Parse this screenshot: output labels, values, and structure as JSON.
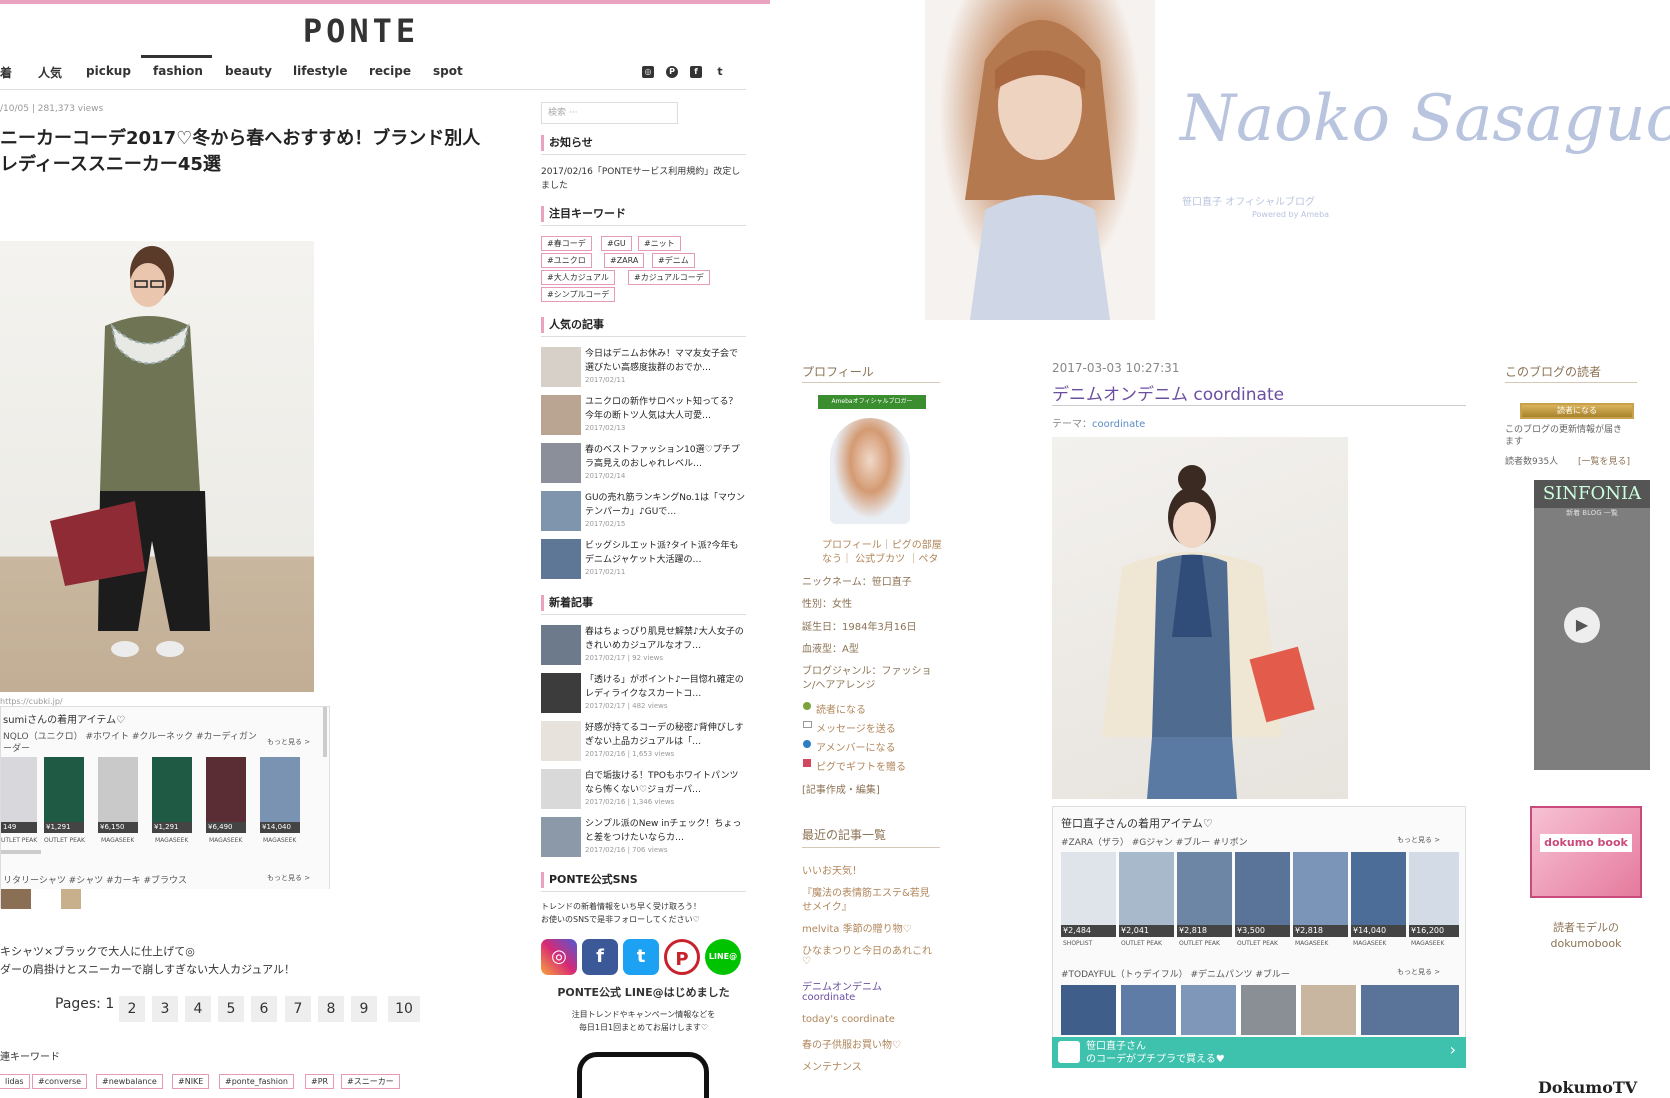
{
  "ponte": {
    "logo": "PONTE",
    "nav": [
      "着",
      "人気",
      "pickup",
      "fashion",
      "beauty",
      "lifestyle",
      "recipe",
      "spot"
    ],
    "social_icons": [
      "instagram-icon",
      "pinterest-icon",
      "facebook-icon",
      "twitter-icon"
    ],
    "meta": "/10/05 | 281,373 views",
    "title_line1": "ニーカーコーデ2017♡冬から春へおすすめ！ブランド別人",
    "title_line2": "レディーススニーカー45選",
    "photo_credit": "https://cubki.jp/",
    "items_box": {
      "heading": "sumiさんの着用アイテム♡",
      "tags_line": "NQLO（ユニクロ） #ホワイト #クルーネック #カーディガン",
      "tags_line2": "ーダー",
      "more": "もっと見る >",
      "prices": [
        "149",
        "¥1,291",
        "¥6,150",
        "¥1,291",
        "¥6,490",
        "¥14,040"
      ],
      "shops": [
        "UTLET PEAK",
        "OUTLET PEAK",
        "MAGASEEK",
        "MAGASEEK",
        "MAGASEEK",
        "MAGASEEK"
      ],
      "tags_line3": "リタリーシャツ #シャツ #カーキ #ブラウス",
      "more2": "もっと見る >"
    },
    "caption1": "キシャツ×ブラックで大人に仕上げて◎",
    "caption2": "ダーの肩掛けとスニーカーで崩しすぎない大人カジュアル！",
    "pages_label": "Pages:",
    "current_page": "1",
    "pages": [
      "2",
      "3",
      "4",
      "5",
      "6",
      "7",
      "8",
      "9",
      "10"
    ],
    "keywords_heading": "連キーワード",
    "bottom_tags": [
      "lidas",
      "#converse",
      "#newbalance",
      "#NIKE",
      "#ponte_fashion",
      "#PR",
      "#スニーカー"
    ],
    "sidebar": {
      "search_placeholder": "検索 ···",
      "news_heading": "お知らせ",
      "news_text": "2017/02/16「PONTEサービス利用規約」改定しました",
      "keywords_heading": "注目キーワード",
      "keyword_tags": [
        "#春コーデ",
        "#GU",
        "#ニット",
        "#ユニクロ",
        "#ZARA",
        "#デニム",
        "#大人カジュアル",
        "#カジュアルコーデ",
        "#シンプルコーデ"
      ],
      "popular_heading": "人気の記事",
      "popular": [
        {
          "title": "今日はデニムお休み！ママ友女子会で選びたい高感度抜群のおでか…",
          "date": "2017/02/11"
        },
        {
          "title": "ユニクロの新作サロペット知ってる？今年の断トツ人気は大人可愛…",
          "date": "2017/02/13"
        },
        {
          "title": "春のベストファッション10選♡プチプラ高見えのおしゃれレベル…",
          "date": "2017/02/14"
        },
        {
          "title": "GUの売れ筋ランキングNo.1は「マウンテンパーカ」♪GUで…",
          "date": "2017/02/15"
        },
        {
          "title": "ビッグシルエット派?タイト派?今年もデニムジャケット大活躍の…",
          "date": "2017/02/11"
        }
      ],
      "new_heading": "新着記事",
      "new_articles": [
        {
          "title": "春はちょっぴり肌見せ解禁♪大人女子のきれいめカジュアルなオフ…",
          "date": "2017/02/17 | 92 views"
        },
        {
          "title": "「透ける」がポイント♪一目惚れ確定のレディライクなスカートコ…",
          "date": "2017/02/17 | 482 views"
        },
        {
          "title": "好感が持てるコーデの秘密♪背伸びしすぎない上品カジュアルは「…",
          "date": "2017/02/16 | 1,653 views"
        },
        {
          "title": "白で垢抜ける！TPOもホワイトパンツなら怖くない♡ジョガーパ…",
          "date": "2017/02/16 | 1,346 views"
        },
        {
          "title": "シンプル派のNew inチェック！ちょっと差をつけたいならカ…",
          "date": "2017/02/16 | 706 views"
        }
      ],
      "sns_heading": "PONTE公式SNS",
      "sns_text1": "トレンドの新着情報をいち早く受け取ろう！",
      "sns_text2": "お使いのSNSで是非フォローしてください♡",
      "sns_buttons": [
        "instagram-icon",
        "facebook-icon",
        "twitter-icon",
        "pinterest-icon",
        "line-icon"
      ],
      "sns_labels": [
        "◎",
        "f",
        "t",
        "P",
        "LINE@"
      ],
      "line_heading": "PONTE公式 LINE@はじめました",
      "line_text1": "注目トレンドやキャンペーン情報などを",
      "line_text2": "毎日1日1回まとめてお届けします♡"
    }
  },
  "ameba": {
    "signature": "Naoko Sasaguchi",
    "blog_sub": "笹口直子 オフィシャルブログ",
    "powered": "Powered by Ameba",
    "profile_heading": "プロフィール",
    "official_badge": "Amebaオフィシャルブロガー",
    "profile_links1": "プロフィール｜ピグの部屋",
    "profile_links2": "なう｜ 公式ブカツ ｜ペタ",
    "nickname": "ニックネーム：笹口直子",
    "gender": "性別：女性",
    "birthday": "誕生日：1984年3月16日",
    "blood": "血液型：A型",
    "genre1": "ブログジャンル：ファッショ",
    "genre2": "ン/ヘアアレンジ",
    "actions": [
      "読者になる",
      "メッセージを送る",
      "アメンバーになる",
      "ピグでギフトを贈る"
    ],
    "edit_link": "[記事作成・編集]",
    "recent_heading": "最近の記事一覧",
    "recent": [
      "いいお天気！",
      "『魔法の表情筋エステ&若見",
      "せメイク』",
      "melvita 季節の贈り物♡",
      "ひなまつりと今日のあれこれ",
      "♡",
      "デニムオンデニム",
      "coordinate",
      "today's coordinate",
      "春の子供服お買い物♡",
      "メンテナンス"
    ],
    "post_date": "2017-03-03 10:27:31",
    "post_title": "デニムオンデニム coordinate",
    "theme_label": "テーマ：",
    "theme_value": "coordinate",
    "items": {
      "heading": "笹口直子さんの着用アイテム♡",
      "tags": "#ZARA（ザラ） #Gジャン #ブルー #リボン",
      "more": "もっと見る >",
      "prices": [
        "¥2,484",
        "¥2,041",
        "¥2,818",
        "¥3,500",
        "¥2,818",
        "¥14,040",
        "¥16,200"
      ],
      "shops": [
        "SHOPLIST",
        "OUTLET PEAK",
        "OUTLET PEAK",
        "OUTLET PEAK",
        "MAGASEEK",
        "MAGASEEK",
        "MAGASEEK"
      ],
      "tags2": "#TODAYFUL（トゥデイフル） #デニムパンツ #ブルー",
      "more2": "もっと見る >",
      "banner1": "笹口直子さん",
      "banner2": "のコーデがプチプラで買える♥"
    },
    "readers_heading": "このブログの読者",
    "reader_button": "読者になる",
    "reader_text1": "このブログの更新情報が届き",
    "reader_text2": "ます",
    "reader_count": "読者数935人",
    "reader_list": "[一覧を見る]",
    "sinfonia": "SINFONIA",
    "sinfonia_sub": "新着 BLOG 一覧",
    "dokumo_label": "dokumo book",
    "dokumo_text1": "読者モデルの",
    "dokumo_text2": "dokumobook",
    "dokumo_logo": "DokumoTV"
  }
}
